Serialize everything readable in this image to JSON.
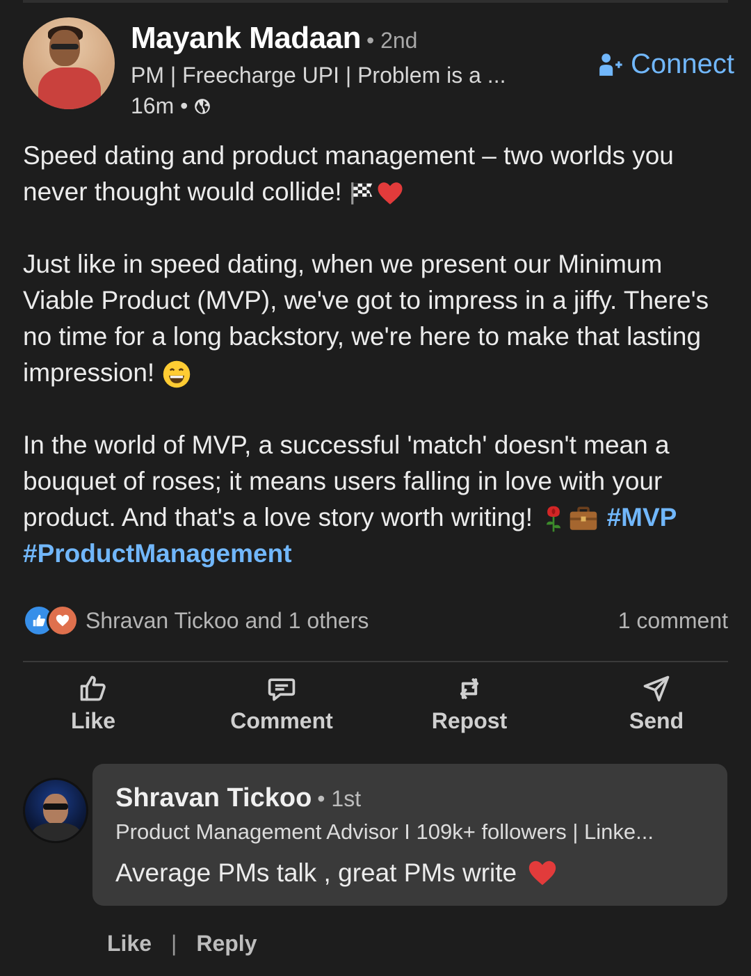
{
  "post": {
    "author": {
      "name": "Mayank Madaan",
      "degree": "• 2nd",
      "headline": "PM | Freecharge UPI | Problem is a ...",
      "time": "16m •",
      "visibility_icon": "globe-icon"
    },
    "connect_label": "Connect",
    "paragraphs": [
      "Speed dating and product management – two worlds you never thought would collide!",
      "Just like in speed dating, when we present our Minimum Viable Product (MVP), we've got to impress in a jiffy. There's no time for a long backstory, we're here to make that lasting impression!",
      "In the world of MVP, a successful 'match' doesn't mean a bouquet of roses; it means users falling in love with your product. And that's a love story worth writing!"
    ],
    "hashtags": [
      "#MVP",
      "#ProductManagement"
    ],
    "emoji": {
      "p1": [
        "checkered-flag-emoji",
        "red-heart-emoji"
      ],
      "p2": [
        "grinning-face-emoji"
      ],
      "p3": [
        "rose-emoji",
        "briefcase-emoji"
      ]
    }
  },
  "social": {
    "reactions": [
      "like-reaction",
      "love-reaction"
    ],
    "reactors": "Shravan Tickoo and 1 others",
    "comment_count": "1 comment"
  },
  "actions": {
    "like": "Like",
    "comment": "Comment",
    "repost": "Repost",
    "send": "Send"
  },
  "comment": {
    "name": "Shravan Tickoo",
    "degree": "• 1st",
    "headline": "Product Management Advisor I 109k+ followers | Linke...",
    "text": "Average PMs talk , great PMs write",
    "like_label": "Like",
    "separator": "|",
    "reply_label": "Reply"
  },
  "colors": {
    "background": "#1d1d1d",
    "link": "#71b7fb",
    "like_blue": "#378fe9",
    "love_orange": "#df704d",
    "bubble": "#3a3a3a"
  }
}
